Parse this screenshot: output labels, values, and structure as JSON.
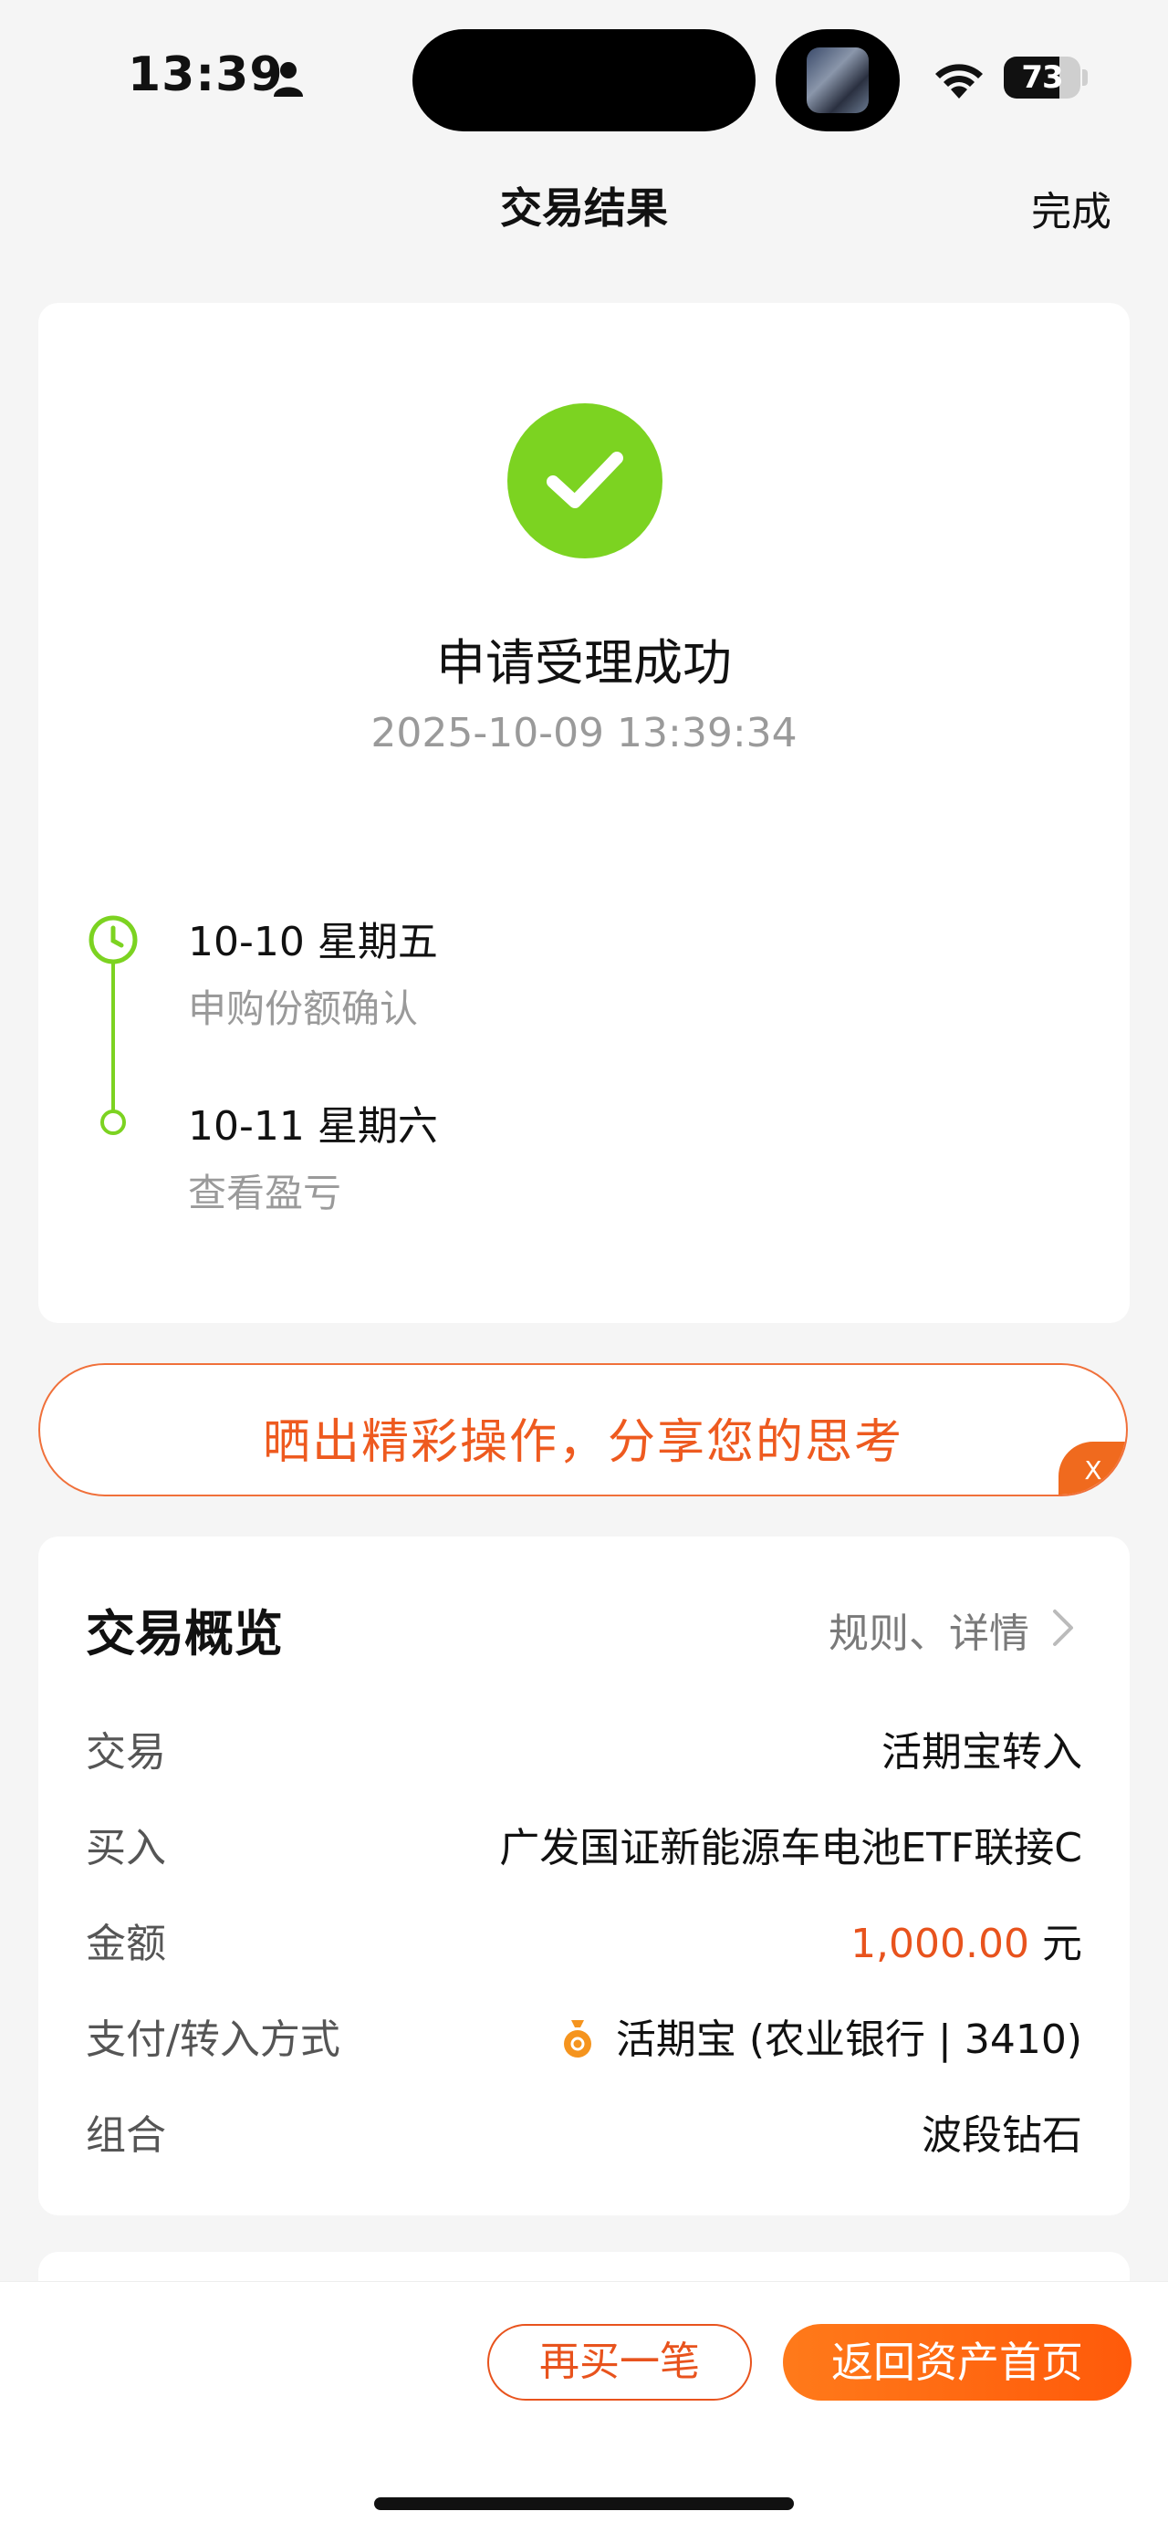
{
  "status_bar": {
    "time": "13:39",
    "battery": "73",
    "battery_level": 0.73
  },
  "nav": {
    "title": "交易结果",
    "done": "完成"
  },
  "result": {
    "title": "申请受理成功",
    "time": "2025-10-09 13:39:34",
    "timeline": [
      {
        "date": "10-10  星期五",
        "desc": "申购份额确认"
      },
      {
        "date": "10-11  星期六",
        "desc": "查看盈亏"
      }
    ]
  },
  "banner": {
    "text": "晒出精彩操作，分享您的思考",
    "close": "X"
  },
  "overview": {
    "title": "交易概览",
    "link": "规则、详情",
    "rows": [
      {
        "label": "交易",
        "value": "活期宝转入"
      },
      {
        "label": "买入",
        "value": "广发国证新能源车电池ETF联接C"
      },
      {
        "label": "金额",
        "amount": "1,000.00",
        "unit": " 元"
      },
      {
        "label": "支付/转入方式",
        "value": "活期宝 (农业银行 | 3410)"
      },
      {
        "label": "组合",
        "value": "波段钻石"
      }
    ]
  },
  "buttons": {
    "buy_again": "再买一笔",
    "back_home": "返回资产首页"
  },
  "colors": {
    "accent": "#e8531d",
    "success": "#7cd321"
  }
}
